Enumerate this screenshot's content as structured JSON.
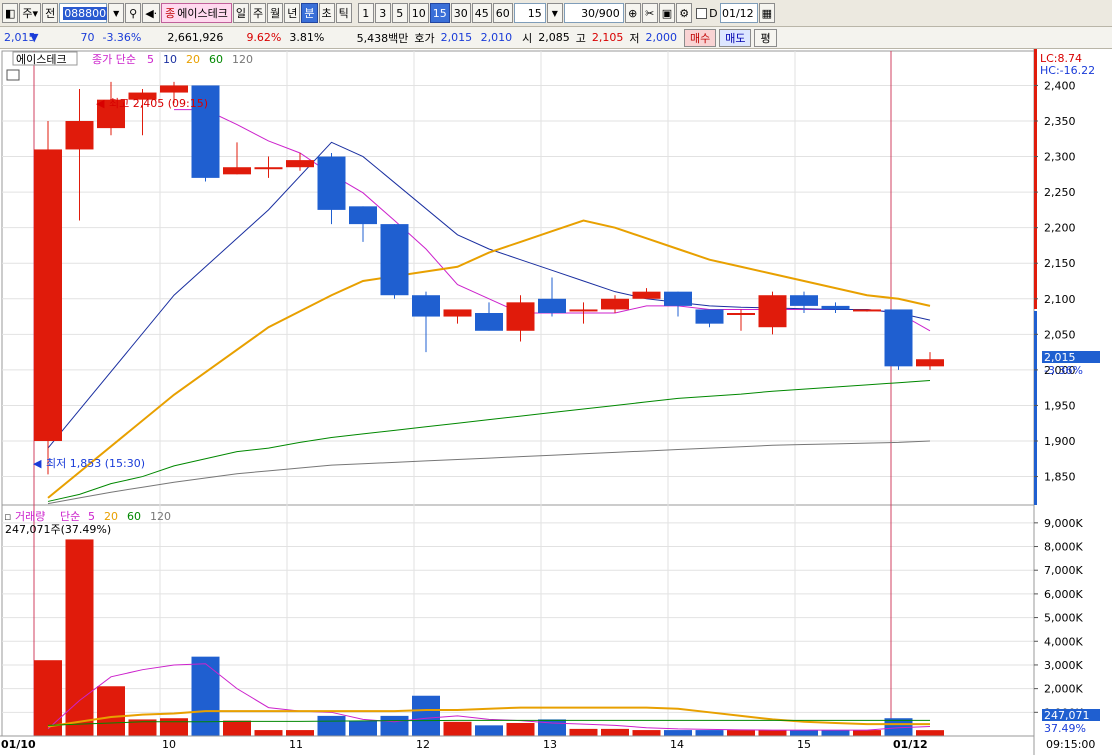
{
  "toolbar": {
    "market_label": "주",
    "market_dd": "▾",
    "prev_label": "전",
    "code": "088800",
    "name_badge": "종",
    "stock_name": "에이스테크",
    "period_buttons": [
      "일",
      "주",
      "월",
      "년",
      "분",
      "초",
      "틱"
    ],
    "selected_period": "분",
    "interval_buttons": [
      "1",
      "3",
      "5",
      "10",
      "15",
      "30",
      "45",
      "60"
    ],
    "selected_interval": "15",
    "interval_value": "15",
    "count_value": "30/900",
    "date_label": "D",
    "date_value": "01/12"
  },
  "quote": {
    "price": "2,015",
    "change_arrow": "▼",
    "change": "70",
    "change_pct": "-3.36%",
    "volume": "2,661,926",
    "ratio1": "9.62%",
    "ratio2": "3.81%",
    "amount": "5,438백만",
    "hoga_label": "호가",
    "ask": "2,015",
    "bid": "2,010",
    "open_label": "시",
    "open": "2,085",
    "high_label": "고",
    "high": "2,105",
    "low_label": "저",
    "low": "2,000",
    "buy_label": "매수",
    "sell_label": "매도",
    "flat_label": "평"
  },
  "price_panel": {
    "stock_tab": "에이스테크",
    "ma_title": "종가 단순",
    "ma_periods": [
      {
        "label": "5",
        "color": "#cc22cc"
      },
      {
        "label": "10",
        "color": "#1a2fa0"
      },
      {
        "label": "20",
        "color": "#e8a000"
      },
      {
        "label": "60",
        "color": "#008800"
      },
      {
        "label": "120",
        "color": "#777777"
      }
    ],
    "lc_label": "LC:8.74",
    "hc_label": "HC:-16.22",
    "high_annotation": "최고 2,405 (09:15)",
    "low_annotation": "최저 1,853 (15:30)",
    "current_price_tag": "2,015",
    "current_pct_tag": "-3.36%",
    "y_ticks": [
      "2,400",
      "2,350",
      "2,300",
      "2,250",
      "2,200",
      "2,150",
      "2,100",
      "2,050",
      "2,000",
      "1,950",
      "1,900",
      "1,850"
    ]
  },
  "volume_panel": {
    "title": "거래량",
    "ma_title": "단순",
    "ma_periods": [
      {
        "label": "5",
        "color": "#cc22cc"
      },
      {
        "label": "20",
        "color": "#e8a000"
      },
      {
        "label": "60",
        "color": "#008800"
      },
      {
        "label": "120",
        "color": "#777777"
      }
    ],
    "info": "247,071주(37.49%)",
    "current_vol_tag": "247,071",
    "current_pct_tag": "37.49%",
    "y_ticks": [
      "9,000K",
      "8,000K",
      "7,000K",
      "6,000K",
      "5,000K",
      "4,000K",
      "3,000K",
      "2,000K",
      "1,000K"
    ]
  },
  "x_axis": {
    "labels": [
      "01/10",
      "10",
      "11",
      "12",
      "13",
      "14",
      "15",
      "01/12"
    ],
    "time_label": "09:15:00"
  },
  "chart_data": {
    "type": "candlestick",
    "price_axis": {
      "min": 1810,
      "max": 2440
    },
    "volume_axis": {
      "min": 0,
      "max": 9500
    },
    "candles": [
      {
        "o": 1900,
        "h": 2350,
        "l": 1853,
        "c": 2310
      },
      {
        "o": 2310,
        "h": 2395,
        "l": 2210,
        "c": 2350
      },
      {
        "o": 2340,
        "h": 2405,
        "l": 2330,
        "c": 2380
      },
      {
        "o": 2380,
        "h": 2395,
        "l": 2330,
        "c": 2390
      },
      {
        "o": 2390,
        "h": 2405,
        "l": 2375,
        "c": 2400
      },
      {
        "o": 2400,
        "h": 2400,
        "l": 2265,
        "c": 2270
      },
      {
        "o": 2275,
        "h": 2320,
        "l": 2275,
        "c": 2285
      },
      {
        "o": 2285,
        "h": 2300,
        "l": 2270,
        "c": 2285
      },
      {
        "o": 2285,
        "h": 2305,
        "l": 2280,
        "c": 2295
      },
      {
        "o": 2300,
        "h": 2305,
        "l": 2205,
        "c": 2225
      },
      {
        "o": 2230,
        "h": 2230,
        "l": 2180,
        "c": 2205
      },
      {
        "o": 2205,
        "h": 2205,
        "l": 2100,
        "c": 2105
      },
      {
        "o": 2105,
        "h": 2110,
        "l": 2025,
        "c": 2075
      },
      {
        "o": 2075,
        "h": 2085,
        "l": 2065,
        "c": 2085
      },
      {
        "o": 2080,
        "h": 2095,
        "l": 2055,
        "c": 2055
      },
      {
        "o": 2055,
        "h": 2105,
        "l": 2040,
        "c": 2095
      },
      {
        "o": 2100,
        "h": 2130,
        "l": 2075,
        "c": 2080
      },
      {
        "o": 2085,
        "h": 2095,
        "l": 2065,
        "c": 2085
      },
      {
        "o": 2085,
        "h": 2105,
        "l": 2080,
        "c": 2100
      },
      {
        "o": 2100,
        "h": 2115,
        "l": 2100,
        "c": 2110
      },
      {
        "o": 2110,
        "h": 2110,
        "l": 2075,
        "c": 2090
      },
      {
        "o": 2085,
        "h": 2085,
        "l": 2060,
        "c": 2065
      },
      {
        "o": 2080,
        "h": 2085,
        "l": 2055,
        "c": 2080
      },
      {
        "o": 2060,
        "h": 2110,
        "l": 2050,
        "c": 2105
      },
      {
        "o": 2105,
        "h": 2110,
        "l": 2080,
        "c": 2090
      },
      {
        "o": 2090,
        "h": 2095,
        "l": 2080,
        "c": 2085
      },
      {
        "o": 2085,
        "h": 2085,
        "l": 2082,
        "c": 2085
      },
      {
        "o": 2085,
        "h": 2085,
        "l": 2000,
        "c": 2005
      },
      {
        "o": 2005,
        "h": 2025,
        "l": 2000,
        "c": 2015
      }
    ],
    "volumes_k": [
      3200,
      8300,
      2100,
      700,
      750,
      3350,
      650,
      250,
      250,
      850,
      650,
      850,
      1700,
      600,
      450,
      550,
      700,
      300,
      300,
      250,
      250,
      250,
      250,
      250,
      250,
      250,
      250,
      750,
      247
    ],
    "ma_price": [
      {
        "name": "5",
        "color": "#cc22cc",
        "values": [
          null,
          null,
          null,
          null,
          2366,
          2366,
          2345,
          2322,
          2305,
          2275,
          2249,
          2210,
          2170,
          2120,
          2100,
          2080,
          2080,
          2080,
          2080,
          2090,
          2090,
          2085,
          2085,
          2085,
          2085,
          2085,
          2085,
          2080,
          2055
        ]
      },
      {
        "name": "10",
        "color": "#1a2fa0",
        "values": [
          1890,
          null,
          null,
          null,
          2105,
          null,
          null,
          2225,
          null,
          2320,
          2300,
          null,
          null,
          2190,
          2170,
          2155,
          2140,
          2125,
          2110,
          2100,
          2095,
          2090,
          2088,
          2087,
          2086,
          2085,
          2085,
          2080,
          2070
        ]
      },
      {
        "name": "20",
        "color": "#e8a000",
        "values": [
          1820,
          null,
          null,
          null,
          1965,
          null,
          null,
          2060,
          null,
          2105,
          2125,
          null,
          null,
          2145,
          2165,
          2180,
          2195,
          2210,
          2200,
          2185,
          2170,
          2155,
          2145,
          2135,
          2125,
          2115,
          2105,
          2100,
          2090
        ]
      },
      {
        "name": "60",
        "color": "#008800",
        "values": [
          1815,
          1825,
          1840,
          1850,
          1865,
          1875,
          1885,
          1890,
          1898,
          1905,
          1910,
          1915,
          1920,
          1925,
          1930,
          1935,
          1940,
          1945,
          1950,
          1955,
          1960,
          1963,
          1966,
          1970,
          1973,
          1976,
          1979,
          1982,
          1985
        ]
      },
      {
        "name": "120",
        "color": "#777777",
        "values": [
          1812,
          1820,
          1828,
          1835,
          1842,
          1848,
          1854,
          1858,
          1862,
          1866,
          1868,
          1870,
          1872,
          1874,
          1876,
          1878,
          1880,
          1882,
          1884,
          1886,
          1888,
          1890,
          1892,
          1894,
          1895,
          1896,
          1897,
          1898,
          1900
        ]
      }
    ],
    "ma_volume": [
      {
        "name": "5",
        "color": "#cc22cc",
        "values": [
          300,
          1500,
          2500,
          2800,
          3000,
          3050,
          2000,
          1200,
          1050,
          1000,
          700,
          600,
          750,
          850,
          700,
          650,
          550,
          500,
          450,
          350,
          300,
          280,
          260,
          250,
          250,
          250,
          250,
          350,
          400
        ]
      },
      {
        "name": "20",
        "color": "#e8a000",
        "values": [
          400,
          600,
          800,
          900,
          950,
          1050,
          1050,
          1050,
          1050,
          1050,
          1050,
          1050,
          1100,
          1100,
          1150,
          1200,
          1200,
          1200,
          1200,
          1200,
          1150,
          1000,
          850,
          700,
          600,
          550,
          500,
          500,
          500
        ]
      },
      {
        "name": "60",
        "color": "#008800",
        "values": [
          450,
          500,
          550,
          600,
          600,
          600,
          620,
          620,
          620,
          630,
          640,
          650,
          650,
          660,
          660,
          660,
          660,
          660,
          660,
          660,
          660,
          660,
          660,
          660,
          660,
          660,
          660,
          660,
          660
        ]
      }
    ]
  }
}
